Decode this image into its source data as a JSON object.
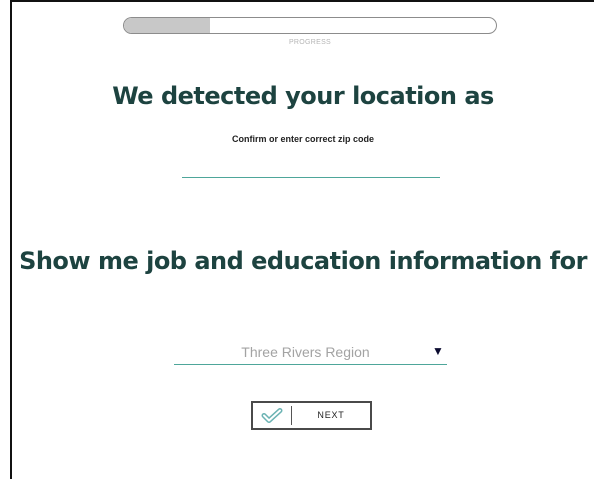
{
  "progress": {
    "label": "PROGRESS",
    "fraction": 0.23
  },
  "location": {
    "heading": "We detected your location as",
    "instruction": "Confirm or enter correct zip code",
    "zip_value": "",
    "zip_placeholder": ""
  },
  "region": {
    "heading": "Show me job and education information for",
    "selected": "Three Rivers Region"
  },
  "next_button": {
    "label": "NEXT",
    "icon": "check-icon"
  },
  "colors": {
    "heading": "#1d4340",
    "accent_line": "#4ea69a",
    "check_icon": "#6bb3b3",
    "progress_fill": "#c8c8c8"
  }
}
